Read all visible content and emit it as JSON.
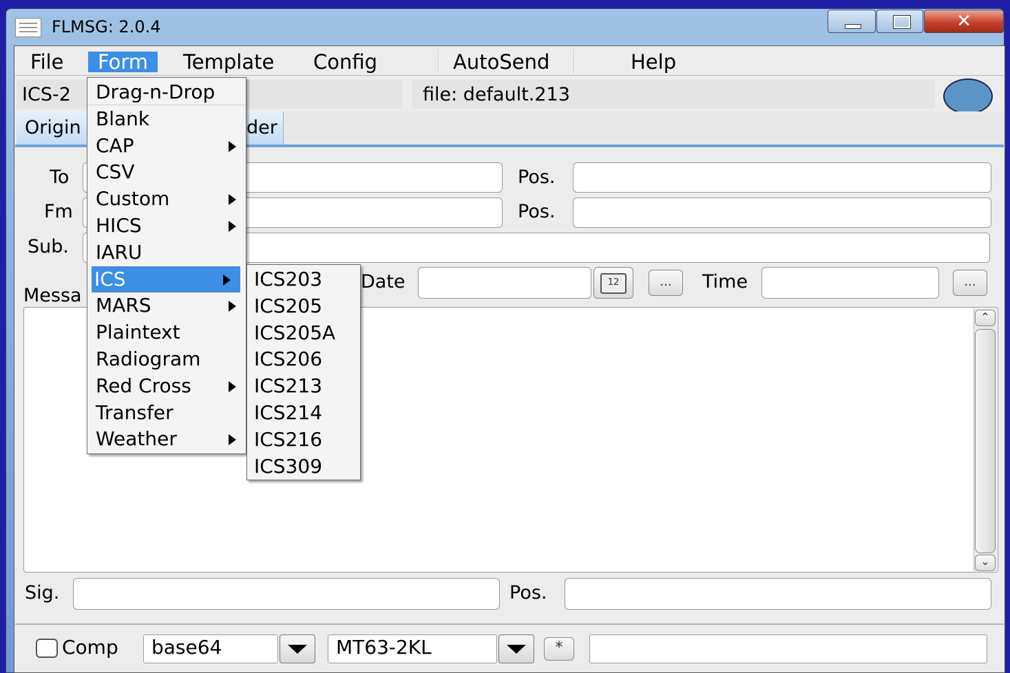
{
  "window": {
    "title": "FLMSG: 2.0.4"
  },
  "menubar": {
    "file": "File",
    "form": "Form",
    "template": "Template",
    "config": "Config",
    "autosend": "AutoSend",
    "help": "Help"
  },
  "header": {
    "form_name": "ICS-2",
    "file_label": "file: default.213",
    "status_color": "#5b95c8"
  },
  "tabs": {
    "originator": "Origin",
    "responder": "der"
  },
  "form": {
    "to_label": "To",
    "fm_label": "Fm",
    "sub_label": "Sub.",
    "pos_label": "Pos.",
    "date_label": "Date",
    "time_label": "Time",
    "message_label": "Messa",
    "sig_label": "Sig.",
    "date_button": "...",
    "time_button": "...",
    "calendar_text": "12"
  },
  "form_menu": {
    "items": [
      {
        "label": "Drag-n-Drop",
        "submenu": false
      },
      {
        "label": "Blank",
        "submenu": false
      },
      {
        "label": "CAP",
        "submenu": true
      },
      {
        "label": "CSV",
        "submenu": false
      },
      {
        "label": "Custom",
        "submenu": true
      },
      {
        "label": "HICS",
        "submenu": true
      },
      {
        "label": "IARU",
        "submenu": false
      },
      {
        "label": "ICS",
        "submenu": true,
        "selected": true
      },
      {
        "label": "MARS",
        "submenu": true
      },
      {
        "label": "Plaintext",
        "submenu": false
      },
      {
        "label": "Radiogram",
        "submenu": false
      },
      {
        "label": "Red Cross",
        "submenu": true
      },
      {
        "label": "Transfer",
        "submenu": false
      },
      {
        "label": "Weather",
        "submenu": true
      }
    ]
  },
  "ics_submenu": {
    "items": [
      "ICS203",
      "ICS205",
      "ICS205A",
      "ICS206",
      "ICS213",
      "ICS214",
      "ICS216",
      "ICS309"
    ]
  },
  "bottom": {
    "comp_label": "Comp",
    "encoding": "base64",
    "mode": "MT63-2KL",
    "star_button": "*",
    "status_text": ""
  }
}
